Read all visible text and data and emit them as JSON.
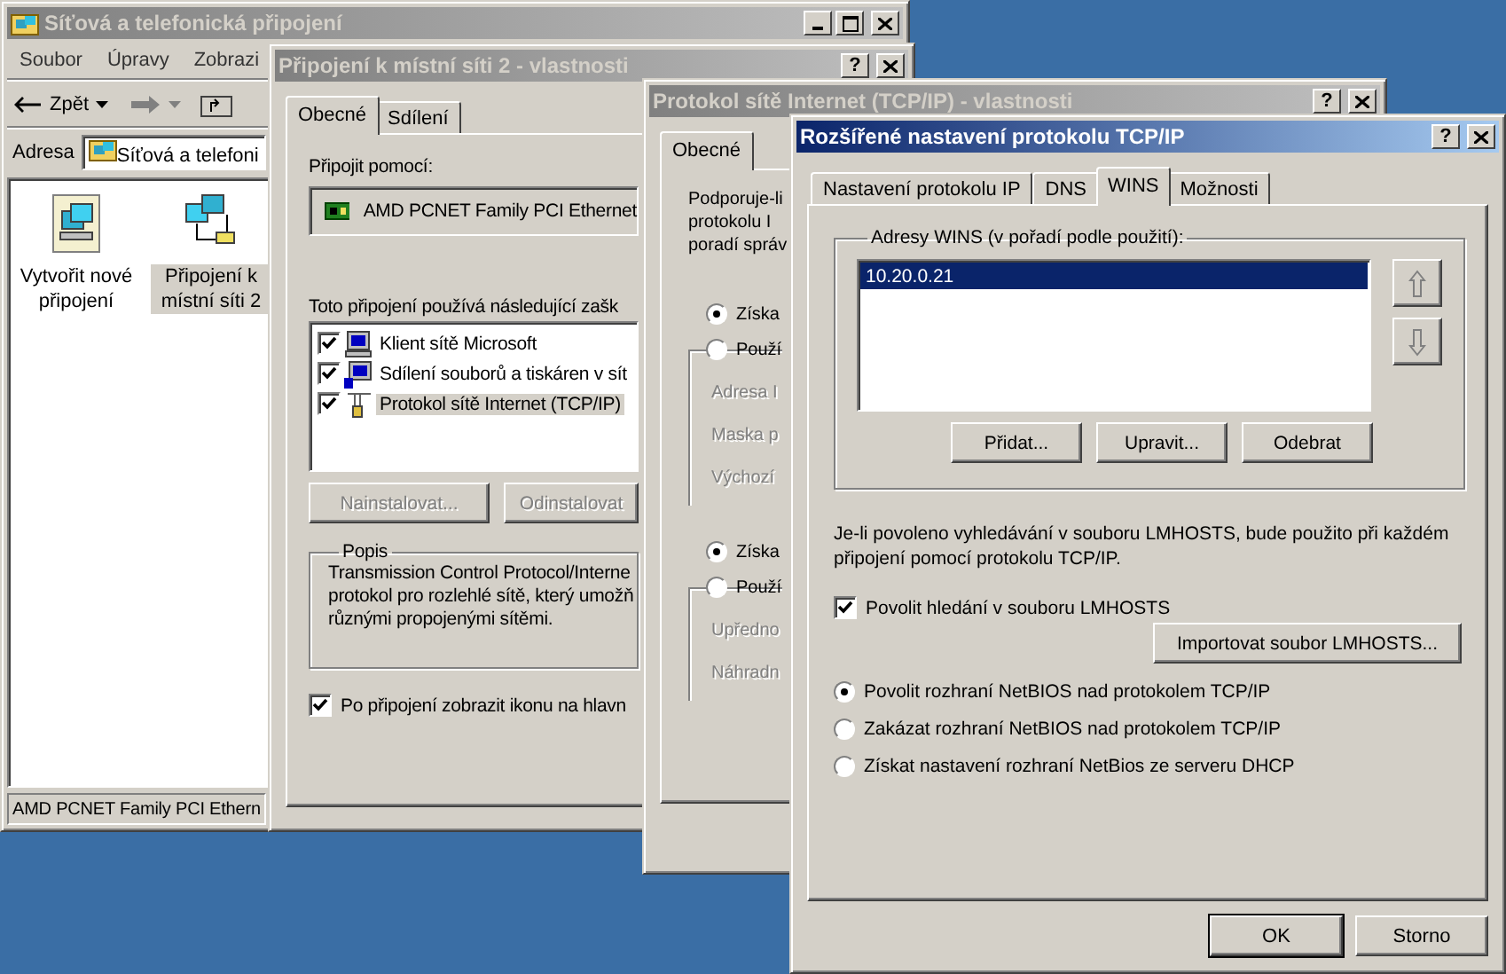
{
  "explorer_window": {
    "title": "Síťová a telefonická připojení",
    "active": false,
    "title_buttons": [
      {
        "kind": "minimize"
      },
      {
        "kind": "maximize"
      },
      {
        "kind": "close"
      }
    ],
    "menu": [
      "Soubor",
      "Úpravy",
      "Zobrazi"
    ],
    "toolbar": {
      "back_label": "Zpět"
    },
    "address": {
      "label": "Adresa",
      "value": "Síťová a telefoni"
    },
    "items": [
      {
        "label": "Vytvořit nové připojení",
        "kind": "wizard",
        "selected": false
      },
      {
        "label": "Připojení k místní síti 2",
        "kind": "lan",
        "selected": true
      }
    ],
    "status_bar": "AMD PCNET Family PCI Ethern"
  },
  "connection_window": {
    "title": "Připojení k místní síti 2 - vlastnosti",
    "active": false,
    "title_buttons": [
      {
        "kind": "help",
        "label": "?"
      },
      {
        "kind": "close"
      }
    ],
    "tabs": [
      {
        "label": "Obecné",
        "selected": true
      },
      {
        "label": "Sdílení",
        "selected": false
      }
    ],
    "connect_using_label": "Připojit pomocí:",
    "adapter": "AMD PCNET Family PCI Ethernet",
    "components_label": "Toto připojení používá následující zašk",
    "components": [
      {
        "label": "Klient sítě Microsoft",
        "kind": "client",
        "checked": true,
        "selected": false
      },
      {
        "label": "Sdílení souborů a tiskáren v sít",
        "kind": "service",
        "checked": true,
        "selected": false
      },
      {
        "label": "Protokol sítě Internet (TCP/IP)",
        "kind": "protocol",
        "checked": true,
        "selected": true
      }
    ],
    "buttons": [
      {
        "label": "Nainstalovat...",
        "disabled": true
      },
      {
        "label": "Odinstalovat",
        "disabled": true
      }
    ],
    "description": {
      "title": "Popis",
      "lines": [
        "Transmission Control Protocol/Interne",
        "protokol pro rozlehlé sítě, který umožň",
        "různými propojenými sítěmi."
      ]
    },
    "show_icon": {
      "label": "Po připojení zobrazit ikonu na hlavn",
      "checked": true
    }
  },
  "tcpip_window": {
    "title": "Protokol sítě Internet (TCP/IP) - vlastnosti",
    "active": false,
    "title_buttons": [
      {
        "kind": "help",
        "label": "?"
      },
      {
        "kind": "close"
      }
    ],
    "tabs": [
      {
        "label": "Obecné",
        "selected": true
      }
    ],
    "intro_lines": [
      "Podporuje-li",
      "protokolu I",
      "poradí správ"
    ],
    "sections": [
      {
        "auto": {
          "label": "Získa",
          "selected": true
        },
        "manual": {
          "label": "Použí",
          "selected": false
        },
        "fields": [
          {
            "label": "Adresa I",
            "disabled": true
          },
          {
            "label": "Maska p",
            "disabled": true
          },
          {
            "label": "Výchozí",
            "disabled": true
          }
        ]
      },
      {
        "auto": {
          "label": "Získa",
          "selected": true
        },
        "manual": {
          "label": "Použí",
          "selected": false
        },
        "fields": [
          {
            "label": "Upředno",
            "disabled": true
          },
          {
            "label": "Náhradn",
            "disabled": true
          }
        ]
      }
    ]
  },
  "advanced_window": {
    "title": "Rozšířené nastavení protokolu TCP/IP",
    "active": true,
    "title_buttons": [
      {
        "kind": "help",
        "label": "?"
      },
      {
        "kind": "close"
      }
    ],
    "tabs": [
      {
        "label": "Nastavení protokolu IP",
        "selected": false
      },
      {
        "label": "DNS",
        "selected": false
      },
      {
        "label": "WINS",
        "selected": true
      },
      {
        "label": "Možnosti",
        "selected": false
      }
    ],
    "wins_group": {
      "title": "Adresy WINS (v pořadí podle použití):",
      "addresses": [
        {
          "value": "10.20.0.21",
          "selected": true
        }
      ],
      "move_up": {
        "disabled": true
      },
      "move_down": {
        "disabled": true
      },
      "buttons": [
        {
          "label": "Přidat...",
          "disabled": false
        },
        {
          "label": "Upravit...",
          "disabled": false
        },
        {
          "label": "Odebrat",
          "disabled": false
        }
      ]
    },
    "lmhosts_note": "Je-li povoleno vyhledávání v souboru LMHOSTS, bude použito při každém připojení pomocí protokolu TCP/IP.",
    "lmhosts_lookup": {
      "label": "Povolit hledání v souboru LMHOSTS",
      "checked": true
    },
    "import_button": "Importovat soubor LMHOSTS...",
    "netbios_options": [
      {
        "label": "Povolit rozhraní NetBIOS nad protokolem TCP/IP",
        "selected": true
      },
      {
        "label": "Zakázat rozhraní NetBIOS nad protokolem TCP/IP",
        "selected": false
      },
      {
        "label": "Získat nastavení rozhraní NetBios ze serveru DHCP",
        "selected": false
      }
    ],
    "dialog_buttons": [
      {
        "label": "OK",
        "default": true
      },
      {
        "label": "Storno",
        "default": false
      }
    ]
  }
}
